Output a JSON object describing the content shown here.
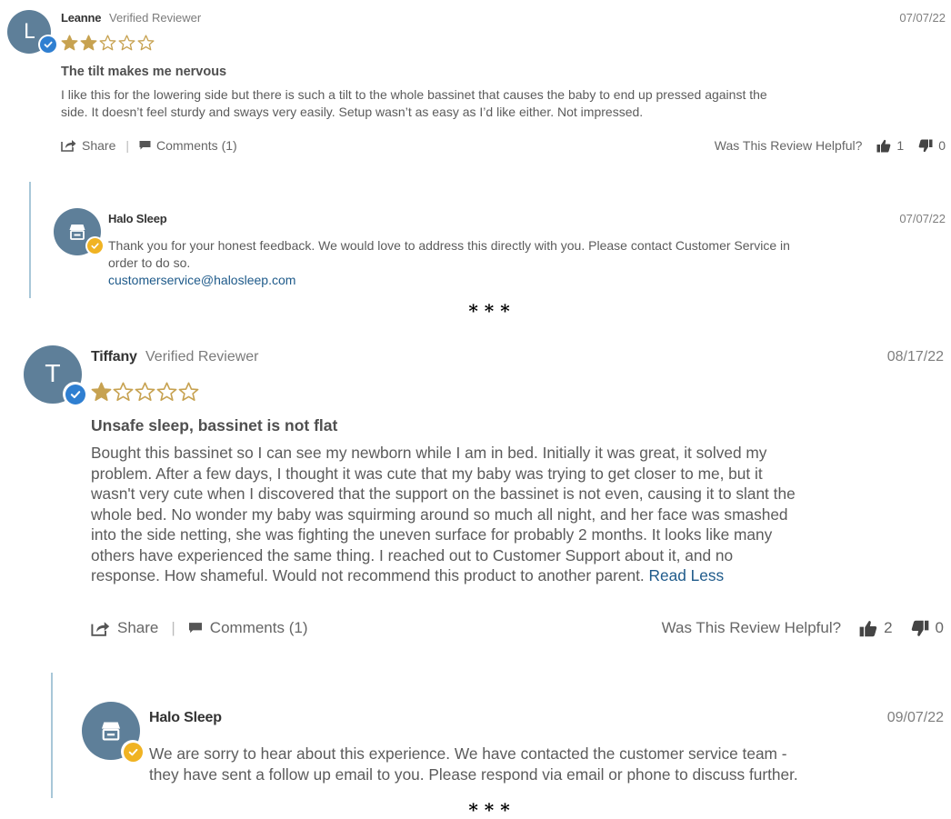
{
  "separator": "* * *",
  "reviews": [
    {
      "avatar_letter": "L",
      "author": "Leanne",
      "verified_label": "Verified Reviewer",
      "date": "07/07/22",
      "rating": 2,
      "rating_max": 5,
      "title": "The tilt makes me nervous",
      "body_lines": [
        "I like this for the lowering side but there is such a tilt to the whole bassinet that causes the baby to end up pressed against the",
        "side. It doesn’t feel sturdy and sways very easily. Setup wasn’t as easy as I’d like either. Not impressed."
      ],
      "share_label": "Share",
      "comments_label": "Comments (1)",
      "helpful_label": "Was This Review Helpful?",
      "helpful_up": "1",
      "helpful_down": "0",
      "reply": {
        "author": "Halo Sleep",
        "date": "07/07/22",
        "body_lines": [
          "Thank you for your honest feedback. We would love to address this directly with you. Please contact Customer Service in",
          "order to do so."
        ],
        "email": "customerservice@halosleep.com"
      }
    },
    {
      "avatar_letter": "T",
      "author": "Tiffany",
      "verified_label": "Verified Reviewer",
      "date": "08/17/22",
      "rating": 1,
      "rating_max": 5,
      "title": "Unsafe sleep, bassinet is not flat",
      "body_lines": [
        "Bought this bassinet so I can see my newborn while I am in bed. Initially it was great, it solved my",
        "problem. After a few days, I thought it was cute that my baby was trying to get closer to me, but it",
        "wasn't very cute when I discovered that the support on the bassinet is not even, causing it to slant the",
        "whole bed. No wonder my baby was squirming around so much all night, and her face was smashed",
        "into the side netting, she was fighting the uneven surface for probably 2 months. It looks like many",
        "others have experienced the same thing. I reached out to Customer Support about it, and no",
        "response. How shameful. Would not recommend this product to another parent."
      ],
      "read_less": "Read Less",
      "share_label": "Share",
      "comments_label": "Comments (1)",
      "helpful_label": "Was This Review Helpful?",
      "helpful_up": "2",
      "helpful_down": "0",
      "reply": {
        "author": "Halo Sleep",
        "date": "09/07/22",
        "body_lines": [
          "We are sorry to hear about this experience. We have contacted the customer service team -",
          "they have sent a follow up email to you. Please respond via email or phone to discuss further."
        ]
      }
    }
  ],
  "icons": {
    "verified_badge": "check-icon",
    "store": "store-icon",
    "share": "share-icon",
    "comment": "comment-icon",
    "thumbs_up": "thumbs-up-icon",
    "thumbs_down": "thumbs-down-icon",
    "star": "star-icon"
  },
  "colors": {
    "avatar": "#5e7f99",
    "verified_badge": "#2f7fd1",
    "store_badge": "#f0b323",
    "star": "#c7a251",
    "link": "#1e5a8a",
    "reply_rule": "#a8c7d8"
  }
}
